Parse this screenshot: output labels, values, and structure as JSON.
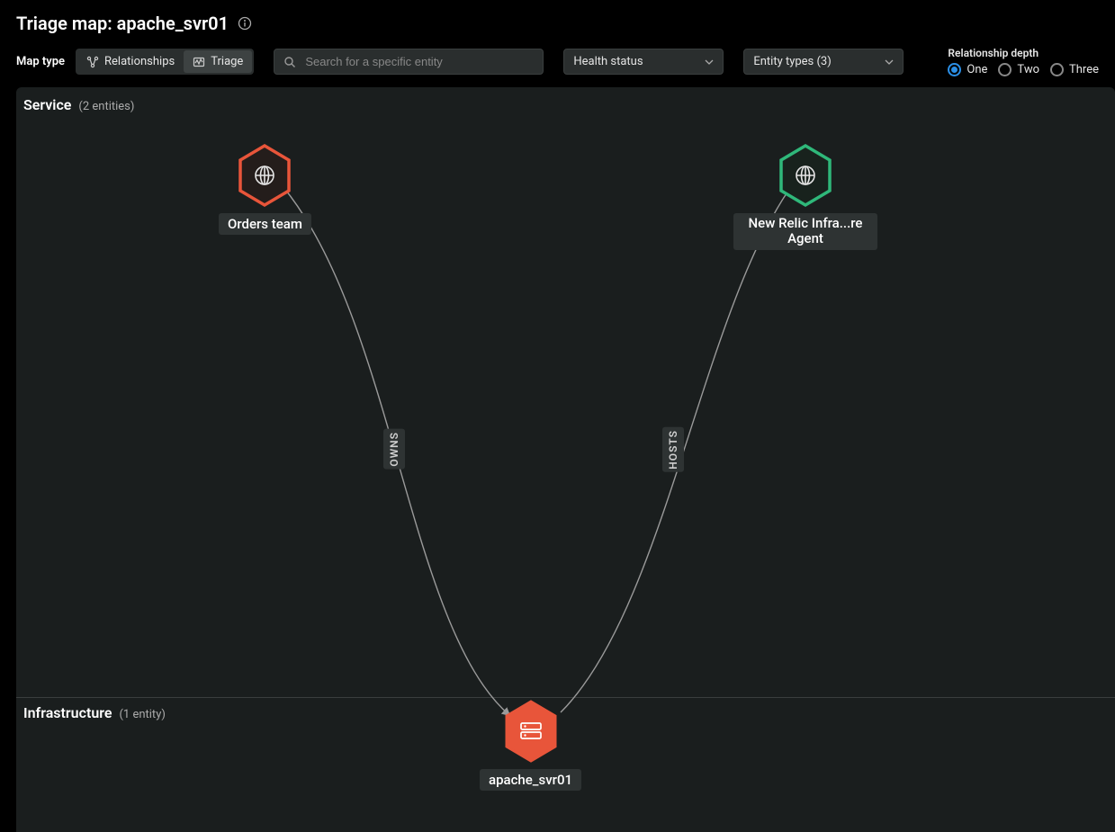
{
  "header": {
    "title": "Triage map: apache_svr01"
  },
  "toolbar": {
    "map_type_label": "Map type",
    "toggle": {
      "relationships": "Relationships",
      "triage": "Triage"
    },
    "search_placeholder": "Search for a specific entity",
    "health_status_label": "Health status",
    "entity_types_label": "Entity types (3)"
  },
  "depth": {
    "label": "Relationship depth",
    "options": {
      "one": "One",
      "two": "Two",
      "three": "Three"
    }
  },
  "sections": {
    "service": {
      "name": "Service",
      "count": "(2 entities)"
    },
    "infra": {
      "name": "Infrastructure",
      "count": "(1 entity)"
    }
  },
  "nodes": {
    "orders": "Orders team",
    "newrelic": "New Relic Infra...re Agent",
    "apache": "apache_svr01"
  },
  "edges": {
    "owns": "OWNS",
    "hosts": "HOSTS"
  },
  "chart_data": {
    "type": "graph",
    "title": "Triage map: apache_svr01",
    "sections": [
      {
        "name": "Service",
        "entity_count": 2
      },
      {
        "name": "Infrastructure",
        "entity_count": 1
      }
    ],
    "nodes": [
      {
        "id": "orders_team",
        "label": "Orders team",
        "section": "Service",
        "status": "critical",
        "icon": "globe"
      },
      {
        "id": "newrelic_infra_agent",
        "label": "New Relic Infra...re Agent",
        "section": "Service",
        "status": "healthy",
        "icon": "globe"
      },
      {
        "id": "apache_svr01",
        "label": "apache_svr01",
        "section": "Infrastructure",
        "status": "critical",
        "icon": "server"
      }
    ],
    "edges": [
      {
        "from": "orders_team",
        "to": "apache_svr01",
        "label": "OWNS"
      },
      {
        "from": "newrelic_infra_agent",
        "to": "apache_svr01",
        "label": "HOSTS"
      }
    ],
    "status_colors": {
      "critical": "#e8553a",
      "healthy": "#2fb87a"
    }
  }
}
